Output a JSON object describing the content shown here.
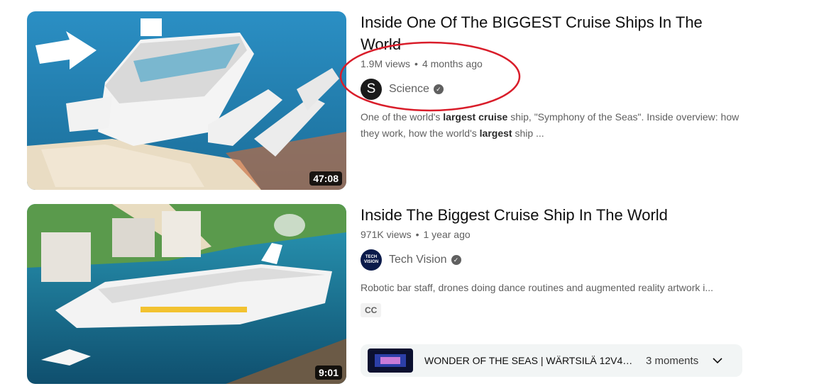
{
  "results": [
    {
      "title": "Inside One Of The BIGGEST Cruise Ships In The World",
      "views": "1.9M views",
      "age": "4 months ago",
      "channel": "Science",
      "avatar_letter": "S",
      "duration": "47:08",
      "desc_parts": [
        "One of the world's ",
        "largest cruise",
        " ship, \"Symphony of the Seas\". Inside overview: how they work, how the world's ",
        "largest",
        " ship ..."
      ]
    },
    {
      "title": "Inside The Biggest Cruise Ship In The World",
      "views": "971K views",
      "age": "1 year ago",
      "channel": "Tech Vision",
      "avatar_text": "TECH VISION",
      "duration": "9:01",
      "description": "Robotic bar staff, drones doing dance routines and augmented reality artwork i...",
      "badge": "CC",
      "moments": {
        "title": "WONDER OF THE SEAS | WÄRTSILÄ 12V46...",
        "count": "3 moments"
      }
    }
  ],
  "separator": "•",
  "verified_glyph": "✓",
  "colors": {
    "annotation": "#d91d2a",
    "meta_text": "#606060",
    "sea": "#1f7fb0"
  },
  "icons": [
    "verified-icon",
    "chevron-down-icon",
    "arrow-icon"
  ]
}
